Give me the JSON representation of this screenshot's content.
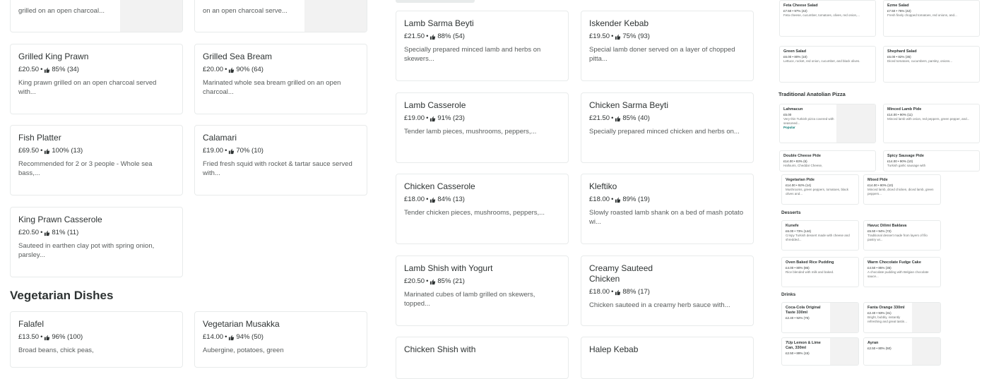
{
  "seafood": [
    {
      "name": "",
      "price": "",
      "rating": "",
      "desc": "grilled on an open charcoal...",
      "top": true
    },
    {
      "name": "",
      "price": "",
      "rating": "",
      "desc": "on an open charcoal serve...",
      "top": true
    },
    {
      "name": "Grilled King Prawn",
      "price": "£20.50",
      "rating": "85% (34)",
      "desc": "King prawn grilled on an open charcoal served with..."
    },
    {
      "name": "Grilled Sea Bream",
      "price": "£20.00",
      "rating": "90% (64)",
      "desc": "Marinated whole sea bream grilled on an open charcoal..."
    },
    {
      "name": "Fish Platter",
      "price": "£69.50",
      "rating": "100% (13)",
      "desc": "Recommended for 2 or 3 people - Whole sea bass,..."
    },
    {
      "name": "Calamari",
      "price": "£19.00",
      "rating": "70% (10)",
      "desc": "Fried fresh squid with rocket & tartar sauce served with..."
    },
    {
      "name": "King Prawn Casserole",
      "price": "£20.50",
      "rating": "81% (11)",
      "desc": "Sauteed in earthen clay pot with spring onion, parsley..."
    }
  ],
  "vegetarian": {
    "title": "Vegetarian Dishes",
    "items": [
      {
        "name": "Falafel",
        "price": "£13.50",
        "rating": "96% (100)",
        "desc": "Broad beans, chick peas,"
      },
      {
        "name": "Vegetarian Musakka",
        "price": "£14.00",
        "rating": "94% (50)",
        "desc": "Aubergine, potatoes, green"
      }
    ]
  },
  "mains": [
    {
      "name": "Lamb Sarma Beyti",
      "price": "£21.50",
      "rating": "88% (54)",
      "desc": "Specially prepared minced lamb and herbs on skewers..."
    },
    {
      "name": "Iskender Kebab",
      "price": "£19.50",
      "rating": "75% (93)",
      "desc": "Special lamb doner served on a layer of chopped pitta..."
    },
    {
      "name": "Lamb Casserole",
      "price": "£19.00",
      "rating": "91% (23)",
      "desc": "Tender lamb pieces, mushrooms, peppers,..."
    },
    {
      "name": "Chicken Sarma Beyti",
      "price": "£21.50",
      "rating": "85% (40)",
      "desc": "Specially prepared minced chicken and herbs on..."
    },
    {
      "name": "Chicken Casserole",
      "price": "£18.00",
      "rating": "84% (13)",
      "desc": "Tender chicken pieces, mushrooms, peppers,..."
    },
    {
      "name": "Kleftiko",
      "price": "£18.00",
      "rating": "89% (19)",
      "desc": "Slowly roasted lamb shank on a bed of mash potato wi..."
    },
    {
      "name": "Lamb Shish with Yogurt",
      "price": "£20.50",
      "rating": "85% (21)",
      "desc": "Marinated cubes of lamb grilled on skewers, topped..."
    },
    {
      "name": "Creamy Sauteed Chicken",
      "price": "£18.00",
      "rating": "88% (17)",
      "desc": "Chicken sauteed in a creamy herb sauce with..."
    },
    {
      "name": "Chicken Shish with",
      "price": "",
      "rating": "",
      "desc": ""
    },
    {
      "name": "Halep Kebab",
      "price": "",
      "rating": "",
      "desc": ""
    }
  ],
  "mini": {
    "salads": [
      {
        "n": "Feta Cheese Salad",
        "m": "£7.50 • 97% (42)",
        "d": "Feta cheese, cucumber, tomatoes, olives, red onion,..."
      },
      {
        "n": "Ezme Salad",
        "m": "£7.50 • 76% (42)",
        "d": "Fresh finely chopped tomatoes, red onions, and..."
      },
      {
        "n": "Green Salad",
        "m": "£6.00 • 80% (10)",
        "d": "Lettuce, rocket, red onion, cucumber, and black olives."
      },
      {
        "n": "Shephard Salad",
        "m": "£6.00 • 82% (35)",
        "d": "Diced tomatoes, cucumbers, parsley, onions..."
      }
    ],
    "pizza_title": "Traditional Anatolian Pizza",
    "pizza": [
      {
        "n": "Lahmacun",
        "m": "£5.00",
        "d": "Very thin Turkish pizza covered with seasoned...",
        "pop": "Popular"
      },
      {
        "n": "Minced Lamb Pide",
        "m": "£14.00 • 90% (11)",
        "d": "Minced lamb with onion, red peppers, green pepper, and..."
      },
      {
        "n": "Double Cheese Pide",
        "m": "£14.00 • 83% (6)",
        "d": "Halloumi, Cheddar Cheese,"
      },
      {
        "n": "Spicy Sausage Pide",
        "m": "£14.00 • 90% (10)",
        "d": "Turkish garlic sausage with"
      },
      {
        "n": "Vegetarian Pide",
        "m": "£14.00 • 92% (14)",
        "d": "Mushrooms, green peppers, tomatoes, black olives and..."
      },
      {
        "n": "Mixed Pide",
        "m": "£14.00 • 80% (10)",
        "d": "Minced lamb, diced chicken, diced lamb, green peppers..."
      }
    ],
    "desserts_title": "Desserts",
    "desserts": [
      {
        "n": "Kunefe",
        "m": "£6.00 • 73% (144)",
        "d": "Crispy Turkish dessert made with cheese and shredded..."
      },
      {
        "n": "Havuc Dilimi Baklava",
        "m": "£5.50 • 94% (72)",
        "d": "Traditional dessert made from layers of filo pastry wi..."
      },
      {
        "n": "Oven Baked Rice Pudding",
        "m": "£4.00 • 80% (86)",
        "d": "Rice blended with milk and baked."
      },
      {
        "n": "Warm Chocolate Fudge Cake",
        "m": "£4.50 • 85% (35)",
        "d": "A chocolate pudding with Belgian chocolate sauce..."
      }
    ],
    "drinks_title": "Drinks",
    "drinks": [
      {
        "n": "Coca-Cola Original Taste 330ml",
        "m": "£2.40 • 92% (75)",
        "d": ""
      },
      {
        "n": "Fanta Orange 330ml",
        "m": "£2.40 • 93% (31)",
        "d": "Bright, bubbly, instantly refreshing and great tastin..."
      },
      {
        "n": "7Up Lemon & Lime Can, 330ml",
        "m": "£2.50 • 89% (15)",
        "d": ""
      },
      {
        "n": "Ayran",
        "m": "£2.50 • 80% (50)",
        "d": ""
      }
    ]
  }
}
